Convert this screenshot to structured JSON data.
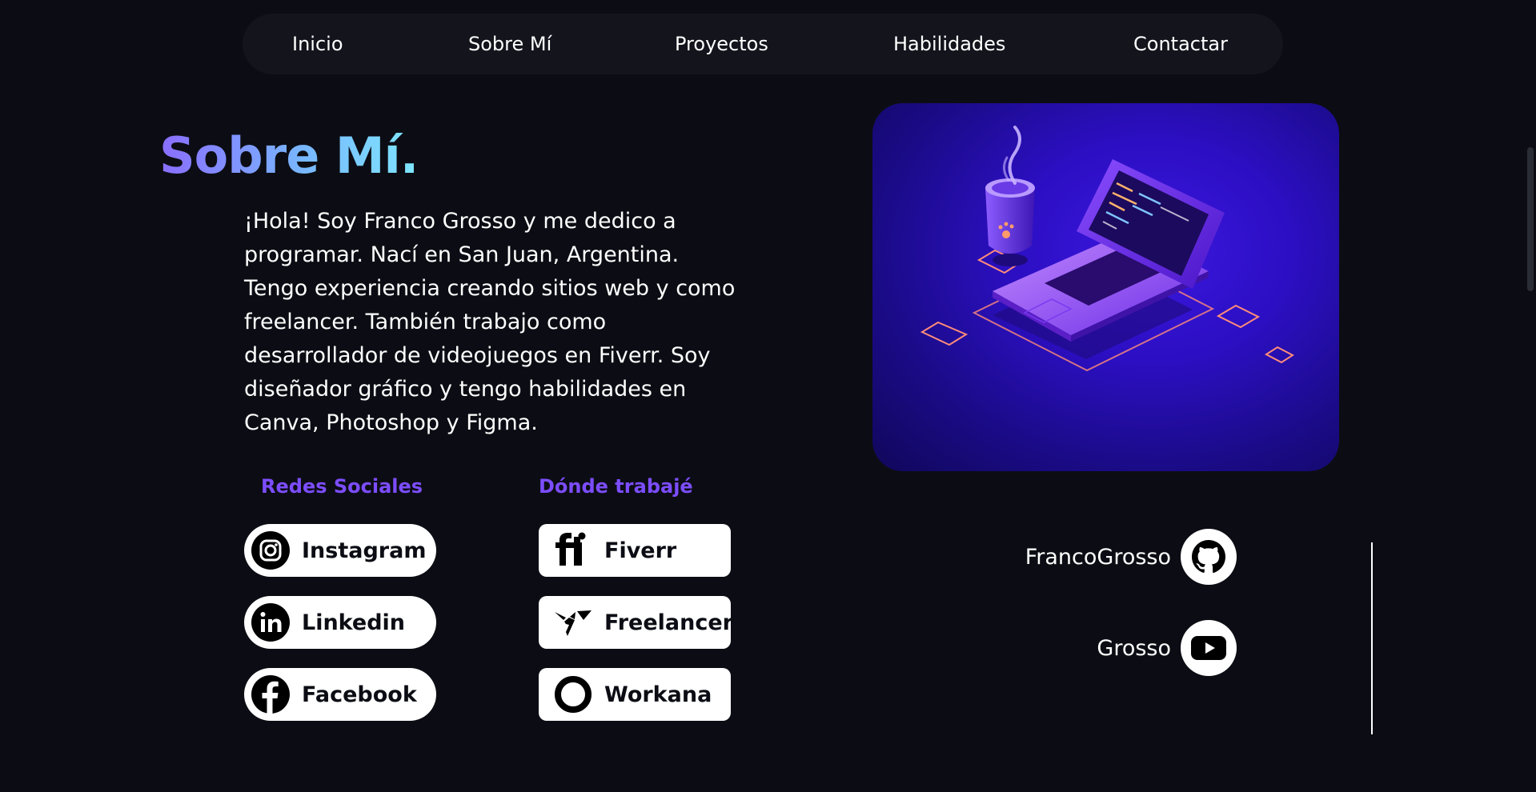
{
  "nav": {
    "items": [
      {
        "label": "Inicio"
      },
      {
        "label": "Sobre Mí"
      },
      {
        "label": "Proyectos"
      },
      {
        "label": "Habilidades"
      },
      {
        "label": "Contactar"
      }
    ]
  },
  "about": {
    "title": "Sobre Mí.",
    "bio": "¡Hola! Soy Franco Grosso y me dedico a programar. Nací en San Juan, Argentina. Tengo experiencia creando sitios web y como freelancer. También trabajo como desarrollador de videojuegos en Fiverr. Soy diseñador gráfico y tengo habilidades en Canva, Photoshop y Figma."
  },
  "social": {
    "title": "Redes Sociales",
    "items": [
      {
        "label": "Instagram",
        "icon": "instagram-icon"
      },
      {
        "label": "Linkedin",
        "icon": "linkedin-icon"
      },
      {
        "label": "Facebook",
        "icon": "facebook-icon"
      }
    ]
  },
  "work": {
    "title": "Dónde trabajé",
    "items": [
      {
        "label": "Fiverr",
        "icon": "fiverr-icon"
      },
      {
        "label": "Freelancer",
        "icon": "freelancer-icon"
      },
      {
        "label": "Workana",
        "icon": "workana-icon"
      }
    ]
  },
  "hero": {
    "image": "isometric-laptop-coffee-illustration"
  },
  "accounts": [
    {
      "name": "FrancoGrosso",
      "icon": "github-icon"
    },
    {
      "name": "Grosso",
      "icon": "youtube-icon"
    }
  ],
  "colors": {
    "background": "#0c0d14",
    "nav_background": "#13141c",
    "accent_purple": "#7c4dff",
    "title_gradient_start": "#8a6dff",
    "title_gradient_end": "#7ee7ff",
    "hero_background": "#2c0fc3"
  }
}
